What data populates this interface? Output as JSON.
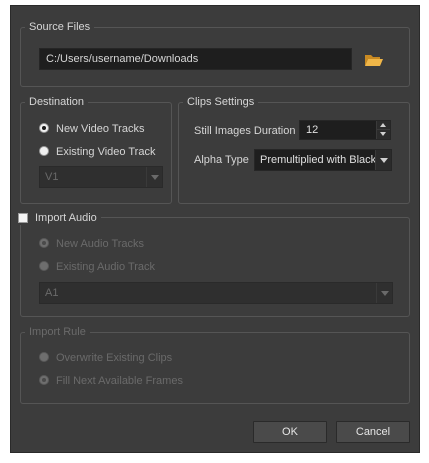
{
  "source_files": {
    "legend": "Source Files",
    "path_value": "C:/Users/username/Downloads",
    "browse_icon": "folder-open-icon"
  },
  "destination": {
    "legend": "Destination",
    "options": [
      {
        "label": "New Video Tracks",
        "checked": true
      },
      {
        "label": "Existing Video Track",
        "checked": false
      }
    ],
    "track_select": "V1"
  },
  "clips_settings": {
    "legend": "Clips Settings",
    "still_duration_label": "Still Images Duration",
    "still_duration_value": "12",
    "alpha_type_label": "Alpha Type",
    "alpha_type_value": "Premultiplied with Black"
  },
  "import_audio": {
    "checkbox_label": "Import Audio",
    "checked": false,
    "options": [
      {
        "label": "New Audio Tracks",
        "checked": true
      },
      {
        "label": "Existing Audio Track",
        "checked": false
      }
    ],
    "track_select": "A1"
  },
  "import_rule": {
    "legend": "Import Rule",
    "options": [
      {
        "label": "Overwrite Existing Clips",
        "checked": false
      },
      {
        "label": "Fill Next Available Frames",
        "checked": true
      }
    ]
  },
  "buttons": {
    "ok": "OK",
    "cancel": "Cancel"
  },
  "colors": {
    "dialog_bg": "#3c3c3c",
    "input_bg": "#1e1e1e",
    "folder_icon": "#e8a93a"
  }
}
